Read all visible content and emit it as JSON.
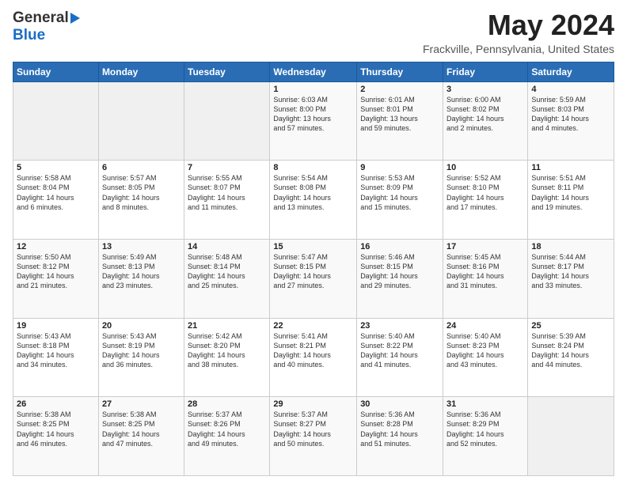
{
  "header": {
    "logo_line1": "General",
    "logo_line2": "Blue",
    "title": "May 2024",
    "location": "Frackville, Pennsylvania, United States"
  },
  "weekdays": [
    "Sunday",
    "Monday",
    "Tuesday",
    "Wednesday",
    "Thursday",
    "Friday",
    "Saturday"
  ],
  "weeks": [
    [
      {
        "day": "",
        "info": ""
      },
      {
        "day": "",
        "info": ""
      },
      {
        "day": "",
        "info": ""
      },
      {
        "day": "1",
        "info": "Sunrise: 6:03 AM\nSunset: 8:00 PM\nDaylight: 13 hours\nand 57 minutes."
      },
      {
        "day": "2",
        "info": "Sunrise: 6:01 AM\nSunset: 8:01 PM\nDaylight: 13 hours\nand 59 minutes."
      },
      {
        "day": "3",
        "info": "Sunrise: 6:00 AM\nSunset: 8:02 PM\nDaylight: 14 hours\nand 2 minutes."
      },
      {
        "day": "4",
        "info": "Sunrise: 5:59 AM\nSunset: 8:03 PM\nDaylight: 14 hours\nand 4 minutes."
      }
    ],
    [
      {
        "day": "5",
        "info": "Sunrise: 5:58 AM\nSunset: 8:04 PM\nDaylight: 14 hours\nand 6 minutes."
      },
      {
        "day": "6",
        "info": "Sunrise: 5:57 AM\nSunset: 8:05 PM\nDaylight: 14 hours\nand 8 minutes."
      },
      {
        "day": "7",
        "info": "Sunrise: 5:55 AM\nSunset: 8:07 PM\nDaylight: 14 hours\nand 11 minutes."
      },
      {
        "day": "8",
        "info": "Sunrise: 5:54 AM\nSunset: 8:08 PM\nDaylight: 14 hours\nand 13 minutes."
      },
      {
        "day": "9",
        "info": "Sunrise: 5:53 AM\nSunset: 8:09 PM\nDaylight: 14 hours\nand 15 minutes."
      },
      {
        "day": "10",
        "info": "Sunrise: 5:52 AM\nSunset: 8:10 PM\nDaylight: 14 hours\nand 17 minutes."
      },
      {
        "day": "11",
        "info": "Sunrise: 5:51 AM\nSunset: 8:11 PM\nDaylight: 14 hours\nand 19 minutes."
      }
    ],
    [
      {
        "day": "12",
        "info": "Sunrise: 5:50 AM\nSunset: 8:12 PM\nDaylight: 14 hours\nand 21 minutes."
      },
      {
        "day": "13",
        "info": "Sunrise: 5:49 AM\nSunset: 8:13 PM\nDaylight: 14 hours\nand 23 minutes."
      },
      {
        "day": "14",
        "info": "Sunrise: 5:48 AM\nSunset: 8:14 PM\nDaylight: 14 hours\nand 25 minutes."
      },
      {
        "day": "15",
        "info": "Sunrise: 5:47 AM\nSunset: 8:15 PM\nDaylight: 14 hours\nand 27 minutes."
      },
      {
        "day": "16",
        "info": "Sunrise: 5:46 AM\nSunset: 8:15 PM\nDaylight: 14 hours\nand 29 minutes."
      },
      {
        "day": "17",
        "info": "Sunrise: 5:45 AM\nSunset: 8:16 PM\nDaylight: 14 hours\nand 31 minutes."
      },
      {
        "day": "18",
        "info": "Sunrise: 5:44 AM\nSunset: 8:17 PM\nDaylight: 14 hours\nand 33 minutes."
      }
    ],
    [
      {
        "day": "19",
        "info": "Sunrise: 5:43 AM\nSunset: 8:18 PM\nDaylight: 14 hours\nand 34 minutes."
      },
      {
        "day": "20",
        "info": "Sunrise: 5:43 AM\nSunset: 8:19 PM\nDaylight: 14 hours\nand 36 minutes."
      },
      {
        "day": "21",
        "info": "Sunrise: 5:42 AM\nSunset: 8:20 PM\nDaylight: 14 hours\nand 38 minutes."
      },
      {
        "day": "22",
        "info": "Sunrise: 5:41 AM\nSunset: 8:21 PM\nDaylight: 14 hours\nand 40 minutes."
      },
      {
        "day": "23",
        "info": "Sunrise: 5:40 AM\nSunset: 8:22 PM\nDaylight: 14 hours\nand 41 minutes."
      },
      {
        "day": "24",
        "info": "Sunrise: 5:40 AM\nSunset: 8:23 PM\nDaylight: 14 hours\nand 43 minutes."
      },
      {
        "day": "25",
        "info": "Sunrise: 5:39 AM\nSunset: 8:24 PM\nDaylight: 14 hours\nand 44 minutes."
      }
    ],
    [
      {
        "day": "26",
        "info": "Sunrise: 5:38 AM\nSunset: 8:25 PM\nDaylight: 14 hours\nand 46 minutes."
      },
      {
        "day": "27",
        "info": "Sunrise: 5:38 AM\nSunset: 8:25 PM\nDaylight: 14 hours\nand 47 minutes."
      },
      {
        "day": "28",
        "info": "Sunrise: 5:37 AM\nSunset: 8:26 PM\nDaylight: 14 hours\nand 49 minutes."
      },
      {
        "day": "29",
        "info": "Sunrise: 5:37 AM\nSunset: 8:27 PM\nDaylight: 14 hours\nand 50 minutes."
      },
      {
        "day": "30",
        "info": "Sunrise: 5:36 AM\nSunset: 8:28 PM\nDaylight: 14 hours\nand 51 minutes."
      },
      {
        "day": "31",
        "info": "Sunrise: 5:36 AM\nSunset: 8:29 PM\nDaylight: 14 hours\nand 52 minutes."
      },
      {
        "day": "",
        "info": ""
      }
    ]
  ]
}
